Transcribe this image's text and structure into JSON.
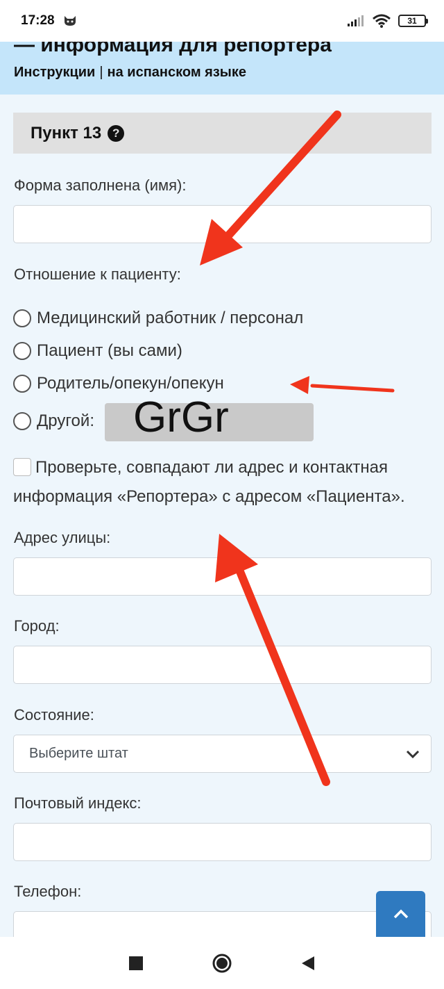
{
  "status_bar": {
    "time": "17:28",
    "battery": "31"
  },
  "header": {
    "title": "— информация для репортера",
    "instructions_link": "Инструкции",
    "separator": "|",
    "spanish_link": "на испанском языке"
  },
  "section": {
    "title": "Пункт 13",
    "help_glyph": "?"
  },
  "form": {
    "filled_by_label": "Форма заполнена (имя):",
    "relation_label": "Отношение к пациенту:",
    "relation_options": [
      "Медицинский работник / персонал",
      "Пациент (вы сами)",
      "Родитель/опекун/опекун",
      "Другой:"
    ],
    "other_value": "GrGr",
    "same_address_text": "Проверьте, совпадают ли адрес и контактная информация «Репортера» с адресом «Пациента».",
    "street_label": "Адрес улицы:",
    "city_label": "Город:",
    "state_label": "Состояние:",
    "state_placeholder": "Выберите штат",
    "zip_label": "Почтовый индекс:",
    "phone_label": "Телефон:"
  },
  "icons": {
    "wifi": "wifi-icon",
    "signal": "signal-icon",
    "scroll_top": "chevron-up-icon",
    "nav_recents": "square-icon",
    "nav_home": "circle-icon",
    "nav_back": "triangle-back-icon"
  },
  "colors": {
    "page_background": "#eef6fc",
    "header_background": "#c4e5fa",
    "scroll_button": "#2f7ac0",
    "annotation_arrow": "#f0341c"
  }
}
